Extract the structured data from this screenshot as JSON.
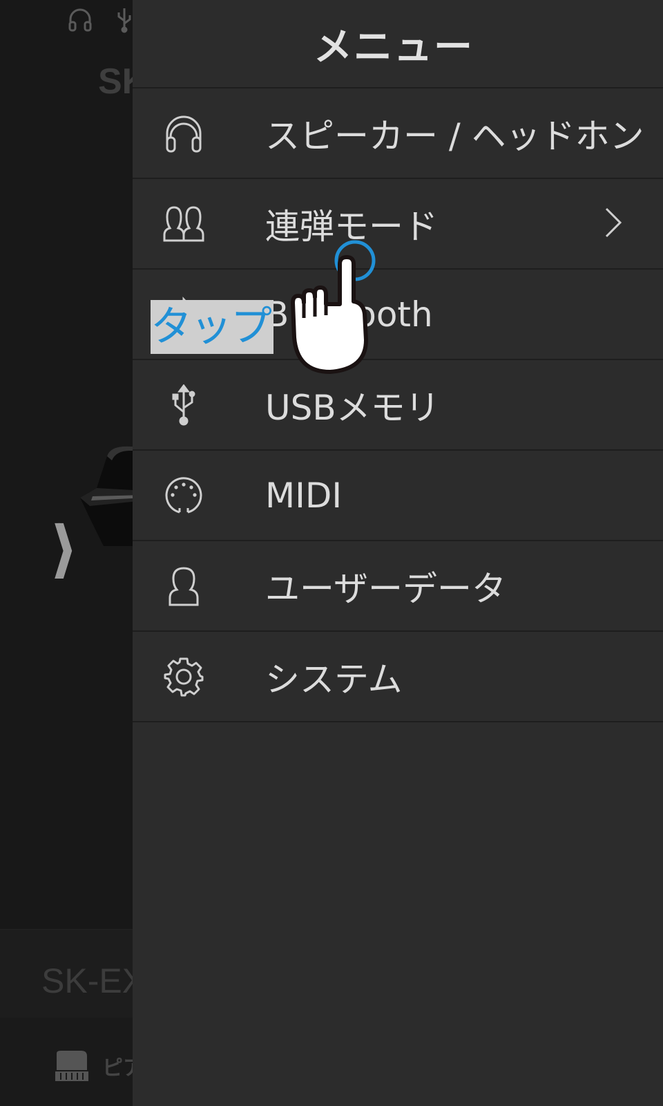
{
  "background": {
    "title": "SK",
    "model": "SK-EX",
    "tone_label": "ピア",
    "status_icons": [
      "headphones-icon",
      "usb-icon"
    ],
    "expand_arrows": "⟩⟩"
  },
  "drawer": {
    "title": "メニュー",
    "items": [
      {
        "label": "スピーカー / ヘッドホン",
        "icon": "headphones-icon",
        "has_submenu": false
      },
      {
        "label": "連弾モード",
        "icon": "duet-icon",
        "has_submenu": true
      },
      {
        "label": "Bluetooth",
        "icon": "bluetooth-icon",
        "has_submenu": false
      },
      {
        "label": "USBメモリ",
        "icon": "usb-icon",
        "has_submenu": false
      },
      {
        "label": "MIDI",
        "icon": "midi-icon",
        "has_submenu": false
      },
      {
        "label": "ユーザーデータ",
        "icon": "user-icon",
        "has_submenu": false
      },
      {
        "label": "システム",
        "icon": "gear-icon",
        "has_submenu": false
      }
    ]
  },
  "tutorial": {
    "tap_label": "タップ",
    "accent_color": "#2190d6"
  }
}
